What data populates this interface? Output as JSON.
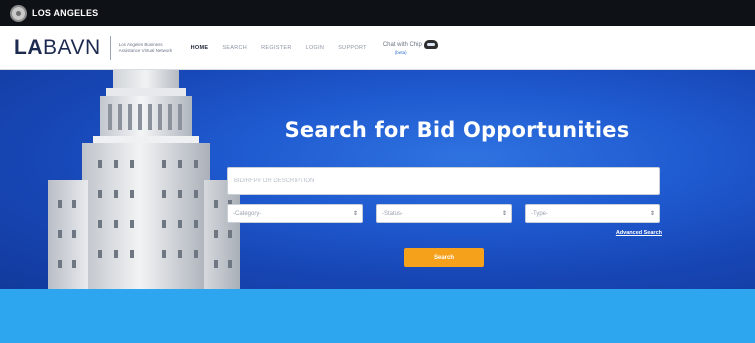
{
  "topbar": {
    "label": "LOS ANGELES",
    "seal_icon": "city-seal-icon"
  },
  "header": {
    "logo_la": "LA",
    "logo_bavn": "BAVN",
    "logo_subtitle": "Los Angeles Business Assistance Virtual Network",
    "nav": [
      {
        "label": "HOME",
        "active": true
      },
      {
        "label": "SEARCH",
        "active": false
      },
      {
        "label": "REGISTER",
        "active": false
      },
      {
        "label": "LOGIN",
        "active": false
      },
      {
        "label": "SUPPORT",
        "active": false
      }
    ],
    "chat_label": "Chat with Chip",
    "chat_beta": "(beta)",
    "chat_icon": "chat-bot-icon"
  },
  "hero": {
    "title": "Search for Bid Opportunities",
    "search_placeholder": "BID/RFP# or DESCRIPTION",
    "category_selected": "-Category-",
    "status_selected": "-Status-",
    "type_selected": "-Type-",
    "advanced_search": "Advanced Search",
    "search_button": "Search"
  },
  "colors": {
    "topbar": "#0e1116",
    "hero_blue": "#1f5ad0",
    "search_button": "#f6a11c",
    "band": "#2ea6ef",
    "logo_text": "#1d2a4f"
  }
}
